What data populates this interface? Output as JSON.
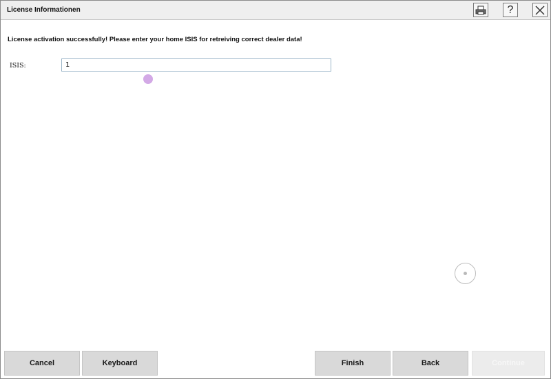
{
  "window": {
    "title": "License Informationen",
    "title_icons": [
      "print-icon",
      "help-icon",
      "close-icon"
    ],
    "help_glyph": "?"
  },
  "main": {
    "message": "License activation successfully! Please enter your home ISIS for retreiving correct dealer data!",
    "isis_label": "ISIS:",
    "isis_value": "1"
  },
  "footer": {
    "cancel_label": "Cancel",
    "keyboard_label": "Keyboard",
    "finish_label": "Finish",
    "back_label": "Back",
    "continue_label": "Continue"
  },
  "colors": {
    "titlebar_bg": "#efefef",
    "button_bg": "#d9d9d9",
    "input_border": "#9ab4c8",
    "cursor_dot": "#d3a9e6"
  }
}
